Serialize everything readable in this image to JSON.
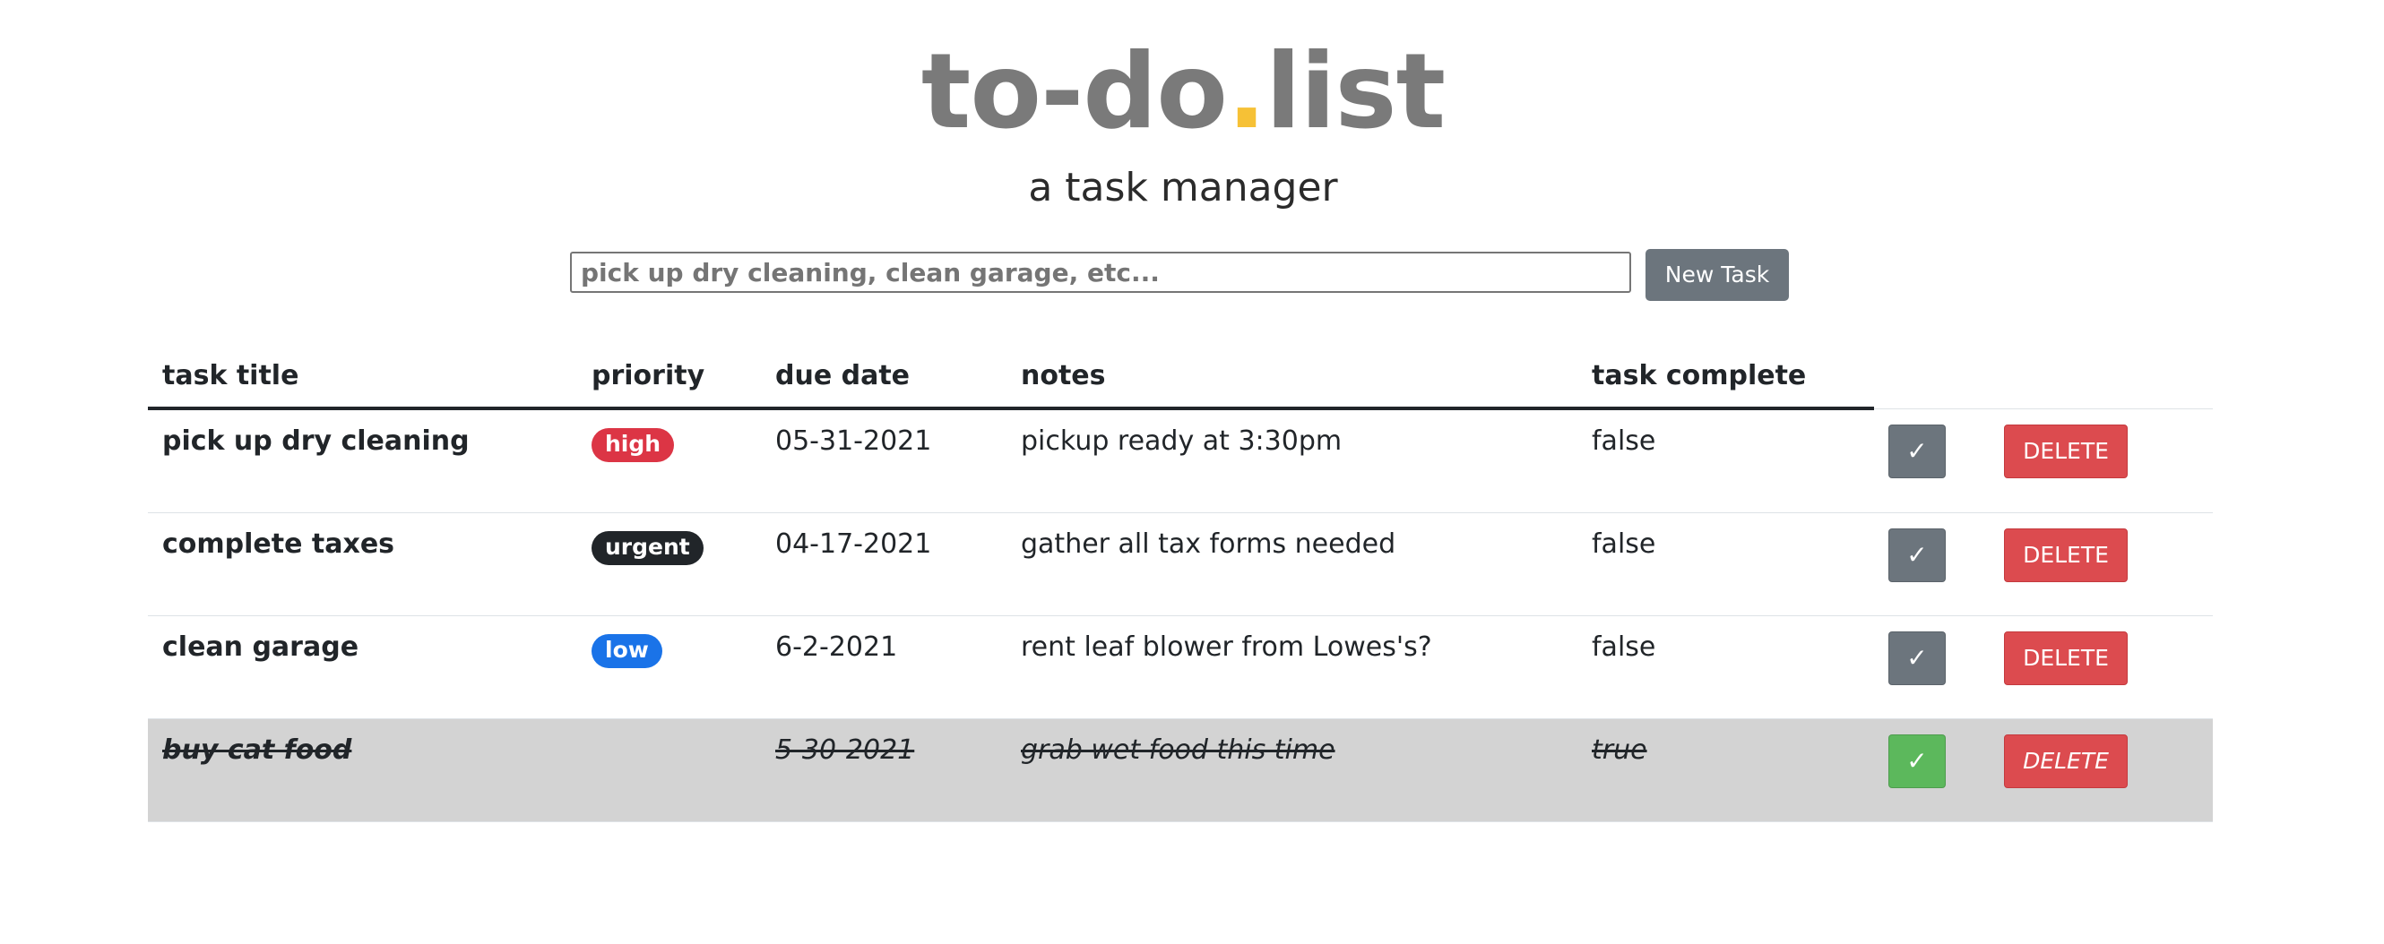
{
  "header": {
    "brand_part1": "to-do",
    "brand_dot": ".",
    "brand_part2": "list",
    "subtitle": "a task manager"
  },
  "form": {
    "placeholder": "pick up dry cleaning, clean garage, etc...",
    "button_label": "New Task"
  },
  "table": {
    "columns": [
      "task title",
      "priority",
      "due date",
      "notes",
      "task complete"
    ],
    "rows": [
      {
        "title": "pick up dry cleaning",
        "priority": "high",
        "priority_color": "#dc3545",
        "due": "05-31-2021",
        "notes": "pickup ready at 3:30pm",
        "complete": "false",
        "check_label": "✓",
        "check_color": "#6c757d",
        "delete_label": "DELETE"
      },
      {
        "title": "complete taxes",
        "priority": "urgent",
        "priority_color": "#212529",
        "due": "04-17-2021",
        "notes": "gather all tax forms needed",
        "complete": "false",
        "check_label": "✓",
        "check_color": "#6c757d",
        "delete_label": "DELETE"
      },
      {
        "title": "clean garage",
        "priority": "low",
        "priority_color": "#1a73e8",
        "due": "6-2-2021",
        "notes": "rent leaf blower from Lowes's?",
        "complete": "false",
        "check_label": "✓",
        "check_color": "#6c757d",
        "delete_label": "DELETE"
      },
      {
        "title": "buy cat food",
        "priority": "",
        "priority_color": "",
        "due": "5-30-2021",
        "notes": "grab wet food this time",
        "complete": "true",
        "check_label": "✓",
        "check_color": "#5cb85c",
        "delete_label": "DELETE"
      }
    ]
  },
  "colors": {
    "accent_dot": "#f6c136",
    "brand_gray": "#7a7a7a",
    "completed_row_bg": "#d3d3d3",
    "delete_red": "#dc4b4f"
  }
}
